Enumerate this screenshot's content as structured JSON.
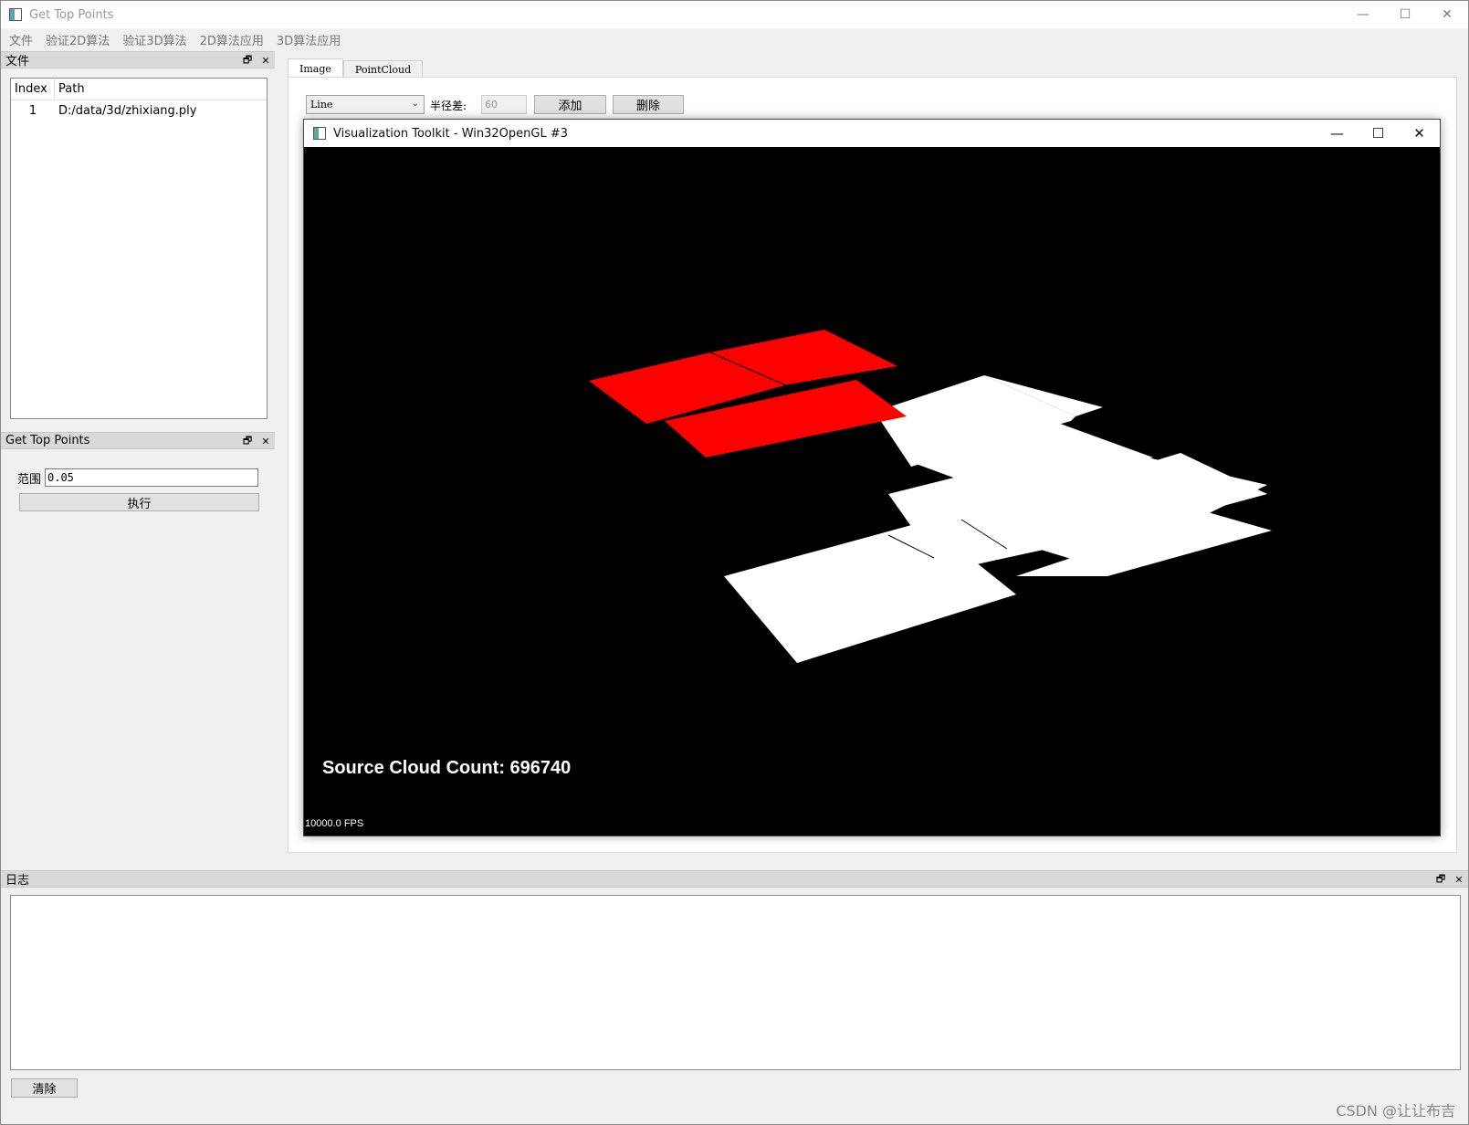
{
  "window": {
    "title": "Get Top Points",
    "controls": {
      "minimize": "—",
      "maximize": "☐",
      "close": "✕"
    }
  },
  "menubar": {
    "items": [
      {
        "label": "文件"
      },
      {
        "label": "验证2D算法"
      },
      {
        "label": "验证3D算法"
      },
      {
        "label": "2D算法应用"
      },
      {
        "label": "3D算法应用"
      }
    ]
  },
  "files_panel": {
    "title": "文件",
    "columns": {
      "index": "Index",
      "path": "Path"
    },
    "rows": [
      {
        "index": "1",
        "path": "D:/data/3d/zhixiang.ply"
      }
    ]
  },
  "get_top_points_panel": {
    "title": "Get Top Points",
    "range_label": "范围",
    "range_value": "0.05",
    "run_label": "执行"
  },
  "tabs": [
    {
      "label": "Image",
      "active": true
    },
    {
      "label": "PointCloud",
      "active": false
    }
  ],
  "toolbar": {
    "shape_selected": "Line",
    "radius_label": "半径差:",
    "radius_value": "60",
    "add_label": "添加",
    "delete_label": "删除"
  },
  "vtk_window": {
    "title": "Visualization Toolkit - Win32OpenGL #3",
    "cloud_count_text": "Source Cloud Count: 696740",
    "fps_text": "10000.0 FPS",
    "colors": {
      "background": "#000000",
      "highlight": "#ff0000",
      "points": "#ffffff"
    }
  },
  "log_panel": {
    "title": "日志",
    "clear_label": "清除"
  },
  "dock_controls": {
    "float": "🗗",
    "close": "✕"
  },
  "watermark": "CSDN @让让布吉"
}
